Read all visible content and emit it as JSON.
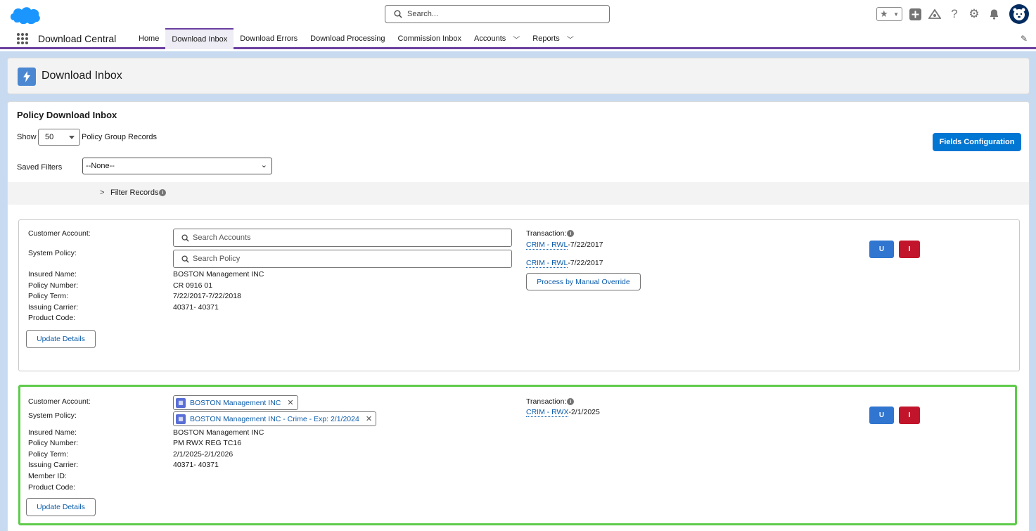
{
  "header": {
    "search_placeholder": "Search...",
    "icons": [
      "salesforce-cloud-logo",
      "star-icon",
      "add-icon",
      "trailhead-icon",
      "help-icon",
      "setup-gear-icon",
      "notification-bell-icon",
      "avatar"
    ]
  },
  "nav": {
    "app_name": "Download Central",
    "tabs": [
      {
        "label": "Home"
      },
      {
        "label": "Download Inbox",
        "active": true
      },
      {
        "label": "Download Errors"
      },
      {
        "label": "Download Processing"
      },
      {
        "label": "Commission Inbox"
      },
      {
        "label": "Accounts",
        "has_menu": true
      },
      {
        "label": "Reports",
        "has_menu": true
      }
    ]
  },
  "page_header": {
    "title": "Download Inbox"
  },
  "card": {
    "title": "Policy Download Inbox",
    "show_label": "Show",
    "show_value": "50",
    "show_suffix": "Policy Group Records",
    "fields_config_button": "Fields Configuration",
    "saved_filters_label": "Saved Filters",
    "saved_filters_value": "--None--",
    "filter_records_label": "Filter Records"
  },
  "labels": {
    "customer_account": "Customer Account:",
    "system_policy": "System Policy:",
    "insured_name": "Insured Name:",
    "policy_number": "Policy Number:",
    "policy_term": "Policy Term:",
    "issuing_carrier": "Issuing Carrier:",
    "member_id": "Member ID:",
    "product_code": "Product Code:",
    "transaction": "Transaction:",
    "update_details": "Update Details",
    "u_button": "U",
    "i_button": "I"
  },
  "records": [
    {
      "customer_account_placeholder": "Search Accounts",
      "system_policy_placeholder": "Search Policy",
      "insured_name": "BOSTON Management INC",
      "policy_number": "CR 0916 01",
      "policy_term": "7/22/2017-7/22/2018",
      "issuing_carrier": "40371- 40371",
      "product_code": "",
      "transactions": [
        {
          "link": "CRIM - RWL",
          "date": "-7/22/2017"
        },
        {
          "link": "CRIM - RWL",
          "date": "-7/22/2017"
        }
      ],
      "manual_override_button": "Process by Manual Override"
    },
    {
      "customer_account": "BOSTON Management INC",
      "system_policy": "BOSTON Management INC - Crime - Exp: 2/1/2024",
      "insured_name": "BOSTON Management INC",
      "policy_number": "PM RWX REG TC16",
      "policy_term": "2/1/2025-2/1/2026",
      "issuing_carrier": "40371- 40371",
      "member_id": "",
      "product_code": "",
      "transactions": [
        {
          "link": "CRIM - RWX",
          "date": "-2/1/2025"
        }
      ]
    }
  ],
  "colors": {
    "brand_blue": "#0176d3",
    "nav_accent": "#6b3fa0",
    "selected_border": "#5ecb4a",
    "danger": "#c2152b"
  }
}
